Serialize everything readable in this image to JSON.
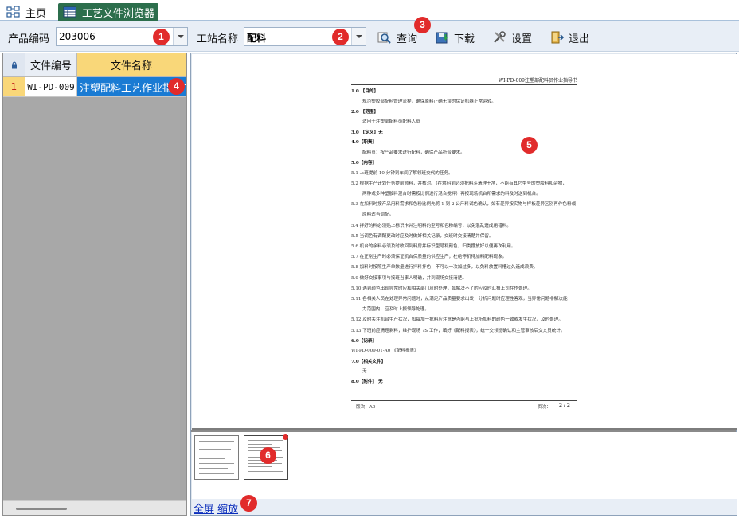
{
  "tabs": [
    {
      "label": "主页"
    },
    {
      "label": "工艺文件浏览器"
    }
  ],
  "toolbar": {
    "product_label": "产品编码",
    "product_value": "203006",
    "station_label": "工站名称",
    "station_value": "配料",
    "query_label": "查询",
    "download_label": "下载",
    "settings_label": "设置",
    "exit_label": "退出"
  },
  "markers": [
    "1",
    "2",
    "3",
    "4",
    "5",
    "6",
    "7"
  ],
  "grid": {
    "headers": {
      "code": "文件编号",
      "name": "文件名称"
    },
    "rows": [
      {
        "index": "1",
        "code": "WI-PD-009",
        "name": "注塑配料工艺作业指导书"
      }
    ]
  },
  "document": {
    "header": "WI-PD-009注塑部配料员作业指导书",
    "lines": [
      "1.0 【目的】",
      "规范塑胶部配料管理流程，确保原料正确无误的保证机器正常运转。",
      "2.0 【范围】",
      "适用于注塑部配料员配料人员",
      "3.0 【定义】无",
      "4.0【职责】",
      "配料员：按产品要求进行配料，确保产品符合要求。",
      "5.0【内容】",
      "5.1 上班提前 10 分钟到车间了解领班交代的任务。",
      "5.2 根据生产计划任务提前领料，并核对。（在烘料前必须把料斗清理干净，不能有其它型号的塑胶料和杂物，",
      "两种或多种塑胶料混合时需按比例进行混合搅拌）再按现场机台所需求的料及时送到机台。",
      "5.3 在加料时按产品用料需求和色粉比例先将 1 到 2 公斤料试色确认，如有差异按实物与样板差异区别再作色粉或",
      "原料适当调配。",
      "5.4 拌好的料必须贴上标识卡并注明料的型号和色粉编号，以免混乱造成用错料。",
      "5.5 当调色有调配更改时应及时做好相关记录，交班时交接清楚并保留。",
      "5.6 机台的余料必须及时收回到料房并标识型号和颜色，归类摆放好以便再次利用。",
      "5.7 在正常生产时必须保证机台保质量的供应生产，杜绝停机待加料配料现象。",
      "5.8 加料时按照生产单数量进行拌料拌色，不可以一次加过多，以免料放置料槽过久造成浪费。",
      "5.9 做好交接事项与接班当事人明确，并到现场交接清楚。",
      "5.10 遇到颜色出现异常时应和相关部门及时处理，如解决不了的应及时汇报上司在作处理。",
      "5.11 各相关人员在处理异常问题时，从满足产品质量要求出发，分析问题时应理性客观，当异常问题非解决能",
      "力范围内，应及时上报领导处理。",
      "5.12 及时关注机台生产状况，如每加一批料应注意是否能与上批所加料的颜色一致或发生状况，及时处理。",
      "5.13 下班前应清理剩料，维护现场 7S 工作，填好《配料报表》，统一交领班确认和主管审核后交文员统计。",
      "6.0【记录】",
      "WI-PD-009-01-A0 《配料报表》",
      "7.0【相关文件】",
      "无",
      "8.0【附件】  无"
    ],
    "footer_left": "版次：A0",
    "footer_right_label": "页次：",
    "footer_right_value": "2 / 2"
  },
  "bottom": {
    "fullscreen": "全屏",
    "zoom": "缩放"
  }
}
